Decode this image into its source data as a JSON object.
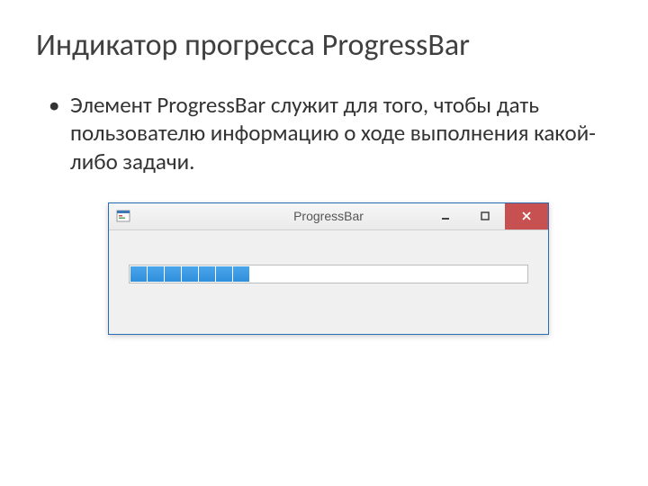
{
  "slide": {
    "title": "Индикатор прогресса ProgressBar",
    "bullet": "Элемент ProgressBar служит для того, чтобы дать пользователю информацию о ходе выполнения какой-либо задачи."
  },
  "window": {
    "title": "ProgressBar",
    "minimize_tooltip": "Minimize",
    "maximize_tooltip": "Maximize",
    "close_tooltip": "Close",
    "progress_blocks": 7,
    "progress_total_estimated": 24
  },
  "colors": {
    "window_border": "#2a6bb5",
    "close_button": "#c75050",
    "progress_fill": "#2f8fdc",
    "client_bg": "#f0f0f0"
  }
}
